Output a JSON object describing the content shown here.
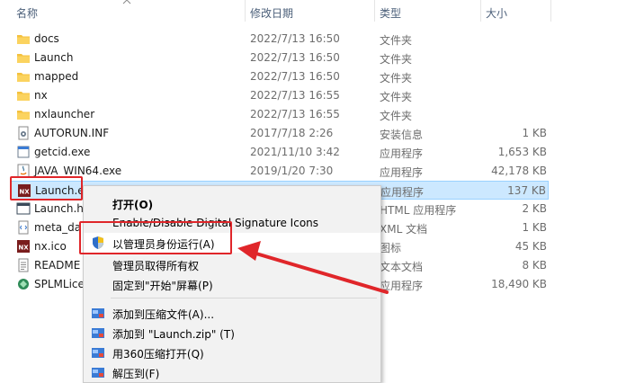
{
  "columns": {
    "name": "名称",
    "date": "修改日期",
    "type": "类型",
    "size": "大小"
  },
  "files": [
    {
      "icon": "folder-icon",
      "name": "docs",
      "date": "2022/7/13 16:50",
      "type": "文件夹",
      "size": ""
    },
    {
      "icon": "folder-icon",
      "name": "Launch",
      "date": "2022/7/13 16:50",
      "type": "文件夹",
      "size": ""
    },
    {
      "icon": "folder-icon",
      "name": "mapped",
      "date": "2022/7/13 16:50",
      "type": "文件夹",
      "size": ""
    },
    {
      "icon": "folder-icon",
      "name": "nx",
      "date": "2022/7/13 16:55",
      "type": "文件夹",
      "size": ""
    },
    {
      "icon": "folder-icon",
      "name": "nxlauncher",
      "date": "2022/7/13 16:55",
      "type": "文件夹",
      "size": ""
    },
    {
      "icon": "settings-file-icon",
      "name": "AUTORUN.INF",
      "date": "2017/7/18 2:26",
      "type": "安装信息",
      "size": "1 KB"
    },
    {
      "icon": "exe-icon",
      "name": "getcid.exe",
      "date": "2021/11/10 3:42",
      "type": "应用程序",
      "size": "1,653 KB"
    },
    {
      "icon": "java-icon",
      "name": "JAVA_WIN64.exe",
      "date": "2019/1/20 7:30",
      "type": "应用程序",
      "size": "42,178 KB"
    },
    {
      "icon": "nx-app-icon",
      "name": "Launch.ex",
      "date": "",
      "type": "应用程序",
      "size": "137 KB"
    },
    {
      "icon": "html-file-icon",
      "name": "Launch.ht",
      "date": "",
      "type": "HTML 应用程序",
      "size": "2 KB"
    },
    {
      "icon": "xml-file-icon",
      "name": "meta_da",
      "date": "",
      "type": "XML 文档",
      "size": "1 KB"
    },
    {
      "icon": "nx-app-icon",
      "name": "nx.ico",
      "date": "",
      "type": "图标",
      "size": "45 KB"
    },
    {
      "icon": "text-file-icon",
      "name": "README",
      "date": "",
      "type": "文本文档",
      "size": "8 KB"
    },
    {
      "icon": "splm-icon",
      "name": "SPLMLice",
      "date": "",
      "type": "应用程序",
      "size": "18,490 KB"
    }
  ],
  "context_menu": {
    "open": "打开(O)",
    "signature": "Enable/Disable Digital Signature Icons",
    "run_as_admin": "以管理员身份运行(A)",
    "take_ownership": "管理员取得所有权",
    "pin_start": "固定到\"开始\"屏幕(P)",
    "add_archive": "添加到压缩文件(A)...",
    "add_zip": "添加到 \"Launch.zip\" (T)",
    "open_360": "用360压缩打开(Q)",
    "extract": "解压到(F)"
  },
  "colors": {
    "accent_red": "#e0262a",
    "selection": "#cce8ff",
    "folder": "#f4c13e"
  }
}
